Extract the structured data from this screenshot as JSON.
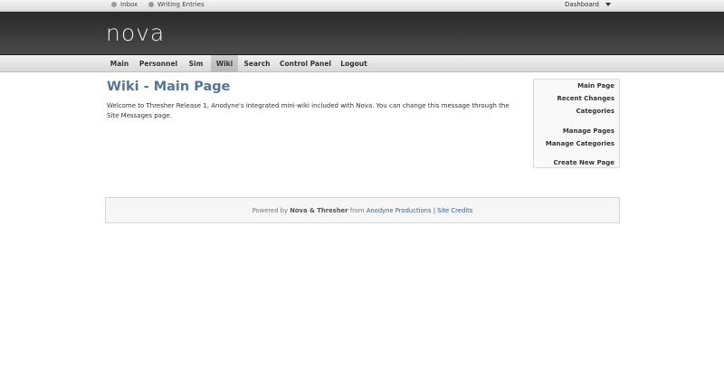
{
  "topbar": {
    "inbox_label": "Inbox",
    "writing_label": "Writing Entries",
    "dashboard_label": "Dashboard"
  },
  "header": {
    "logo_text": "nova"
  },
  "nav": {
    "items": [
      {
        "label": "Main"
      },
      {
        "label": "Personnel"
      },
      {
        "label": "Sim"
      },
      {
        "label": "Wiki"
      },
      {
        "label": "Search"
      },
      {
        "label": "Control Panel"
      },
      {
        "label": "Logout"
      }
    ],
    "active": "Wiki"
  },
  "main": {
    "title": "Wiki - Main Page",
    "welcome_text": "Welcome to Thresher Release 1, Anodyne's integrated mini-wiki included with Nova. You can change this message through the Site Messages page."
  },
  "sidebar": {
    "items": [
      {
        "label": "Main Page"
      },
      {
        "label": "Recent Changes"
      },
      {
        "label": "Categories"
      },
      {
        "label": "Manage Pages"
      },
      {
        "label": "Manage Categories"
      },
      {
        "label": "Create New Page"
      }
    ]
  },
  "footer": {
    "powered_by": "Powered by",
    "nova_thresher": "Nova & Thresher",
    "from": "from",
    "anodyne_link": "Anodyne Productions",
    "separator": "|",
    "credits_link": "Site Credits"
  },
  "colors": {
    "accent_title": "#51759c",
    "link": "#2f5f8f",
    "header_bg": "#333333"
  }
}
